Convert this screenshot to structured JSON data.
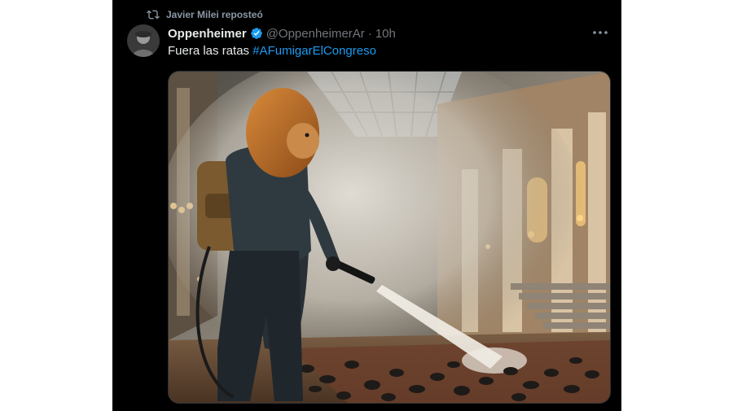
{
  "repost": {
    "label": "Javier Milei reposteó",
    "icon": "repost-icon"
  },
  "author": {
    "name": "Oppenheimer",
    "handle": "@OppenheimerAr",
    "separator": "·",
    "time": "10h",
    "verified_color": "#1d9bf0"
  },
  "tweet": {
    "text": "Fuera las ratas",
    "hashtag": "#AFumigarElCongreso"
  },
  "media": {
    "description_icon": "image-lion-fumigating-congress"
  },
  "colors": {
    "background": "#000000",
    "text": "#e7e9ea",
    "muted": "#71767b",
    "link": "#1d9bf0"
  }
}
